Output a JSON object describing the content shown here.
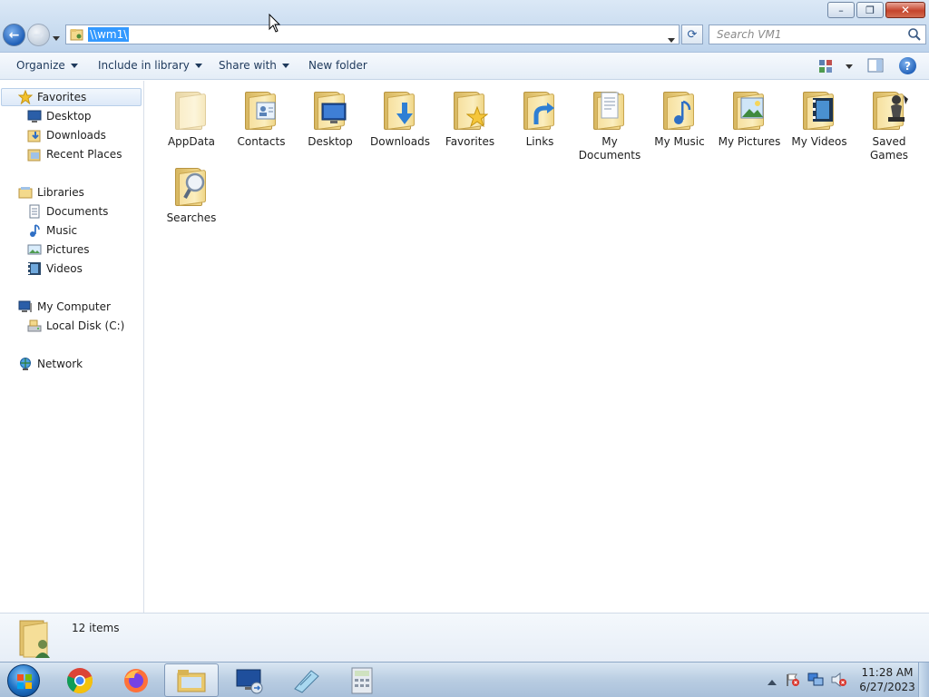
{
  "window": {
    "address": "\\\\wm1\\",
    "search_placeholder": "Search VM1",
    "buttons": {
      "minimize": "–",
      "maximize": "❐",
      "close": "✕"
    },
    "nav": {
      "back": "←",
      "forward": "→",
      "refresh": "⟳"
    }
  },
  "commandbar": {
    "organize": "Organize",
    "include_in_library": "Include in library",
    "share_with": "Share with",
    "new_folder": "New folder",
    "help": "?"
  },
  "navpane": {
    "favorites": {
      "label": "Favorites",
      "items": [
        {
          "label": "Desktop",
          "icon": "desktop-icon"
        },
        {
          "label": "Downloads",
          "icon": "downloads-icon"
        },
        {
          "label": "Recent Places",
          "icon": "recent-places-icon"
        }
      ]
    },
    "libraries": {
      "label": "Libraries",
      "items": [
        {
          "label": "Documents",
          "icon": "documents-icon"
        },
        {
          "label": "Music",
          "icon": "music-icon"
        },
        {
          "label": "Pictures",
          "icon": "pictures-icon"
        },
        {
          "label": "Videos",
          "icon": "videos-icon"
        }
      ]
    },
    "computer": {
      "label": "My Computer",
      "items": [
        {
          "label": "Local Disk (C:)",
          "icon": "local-disk-icon"
        }
      ]
    },
    "network": {
      "label": "Network"
    }
  },
  "folders": [
    {
      "label": "AppData",
      "icon": "folder-appdata-icon"
    },
    {
      "label": "Contacts",
      "icon": "folder-contacts-icon"
    },
    {
      "label": "Desktop",
      "icon": "folder-desktop-icon"
    },
    {
      "label": "Downloads",
      "icon": "folder-downloads-icon"
    },
    {
      "label": "Favorites",
      "icon": "folder-favorites-icon"
    },
    {
      "label": "Links",
      "icon": "folder-links-icon"
    },
    {
      "label": "My\nDocuments",
      "icon": "folder-documents-icon"
    },
    {
      "label": "My Music",
      "icon": "folder-music-icon"
    },
    {
      "label": "My Pictures",
      "icon": "folder-pictures-icon"
    },
    {
      "label": "My Videos",
      "icon": "folder-videos-icon"
    },
    {
      "label": "Saved\nGames",
      "icon": "folder-saved-games-icon"
    },
    {
      "label": "Searches",
      "icon": "folder-searches-icon"
    }
  ],
  "status": {
    "count_text": "12 items"
  },
  "taskbar": {
    "apps": [
      {
        "name": "chrome",
        "icon": "chrome-icon",
        "state": "pinned"
      },
      {
        "name": "firefox",
        "icon": "firefox-icon",
        "state": "pinned"
      },
      {
        "name": "explorer",
        "icon": "explorer-icon",
        "state": "active"
      },
      {
        "name": "remote-desktop",
        "icon": "remote-desktop-icon",
        "state": "pinned"
      },
      {
        "name": "notepad",
        "icon": "notepad-icon",
        "state": "pinned"
      },
      {
        "name": "calculator",
        "icon": "calculator-icon",
        "state": "pinned"
      }
    ],
    "clock": {
      "time": "11:28 AM",
      "date": "6/27/2023"
    }
  },
  "colors": {
    "selection": "#3399ff",
    "chrome_blue": "#1d6fc2",
    "folder_yellow": "#f3d98c"
  }
}
